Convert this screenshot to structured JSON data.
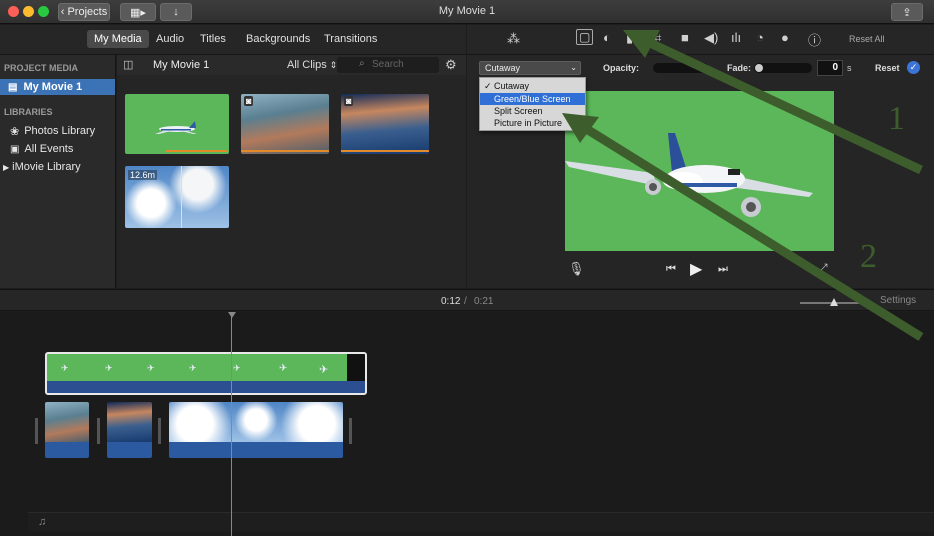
{
  "window": {
    "title": "My Movie 1",
    "projects_label": "Projects"
  },
  "browser_tabs": [
    "My Media",
    "Audio",
    "Titles",
    "Backgrounds",
    "Transitions"
  ],
  "sidebar": {
    "project_media_header": "PROJECT MEDIA",
    "project_item": "My Movie 1",
    "libraries_header": "LIBRARIES",
    "library_items": [
      "Photos Library",
      "All Events",
      "iMovie Library"
    ]
  },
  "media": {
    "title": "My Movie 1",
    "filter": "All Clips",
    "search_placeholder": "Search",
    "clip_duration": "12.6m"
  },
  "viewer_toolbar": {
    "reset_all": "Reset All"
  },
  "overlay_controls": {
    "selected": "Cutaway",
    "opacity_label": "Opacity:",
    "fade_label": "Fade:",
    "fade_value": "0",
    "fade_unit": "s",
    "reset_label": "Reset",
    "menu_items": [
      "Cutaway",
      "Green/Blue Screen",
      "Split Screen",
      "Picture in Picture"
    ]
  },
  "annotations": {
    "label_1": "1",
    "label_2": "2"
  },
  "timeline": {
    "current_time": "0:12",
    "separator": "/",
    "total_time": "0:21",
    "settings_label": "Settings"
  },
  "colors": {
    "accent_blue": "#3c73b6",
    "green_screen": "#5bb75a",
    "annotation_arrow": "#3d5d2c"
  }
}
